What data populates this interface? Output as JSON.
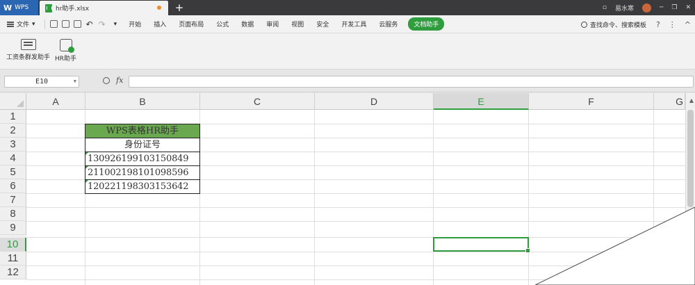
{
  "titlebar": {
    "app_label": "WPS",
    "doc_tab": "hr助手.xlsx",
    "new_tab": "+",
    "user_name": "易水寒",
    "win_controls": [
      "▫",
      "─",
      "❐",
      "✕"
    ]
  },
  "menubar": {
    "file": "文件",
    "file_arrow": "▾",
    "undo": "↶",
    "redo": "↷",
    "more": "▾",
    "items": [
      "开始",
      "插入",
      "页面布局",
      "公式",
      "数据",
      "审阅",
      "视图",
      "安全",
      "开发工具",
      "云服务"
    ],
    "active_item": "文档助手",
    "search_label": "查找命令、搜索模板",
    "help": "?",
    "more_dots": "⋮",
    "collapse": "^"
  },
  "ribbon": {
    "btn1": "工资条群发助手",
    "btn2": "HR助手"
  },
  "formulabar": {
    "namebox": "E10",
    "fx": "fx",
    "formula": ""
  },
  "sheet": {
    "columns": [
      "A",
      "B",
      "C",
      "D",
      "E",
      "F",
      "G"
    ],
    "rows": [
      "1",
      "2",
      "3",
      "4",
      "5",
      "6",
      "7",
      "8",
      "9",
      "10",
      "11",
      "12"
    ],
    "selected_column": "E",
    "selected_row": "10",
    "b2_title": "WPS表格HR助手",
    "b3_header": "身份证号",
    "ids": [
      "130926199103150849",
      "211002198101098596",
      "120221198303153642"
    ]
  },
  "colors": {
    "accent_green": "#2f9d3e",
    "title_fill": "#6aa84f",
    "titlebar_bg": "#3a3a3c",
    "wps_blue": "#2b66b2"
  }
}
